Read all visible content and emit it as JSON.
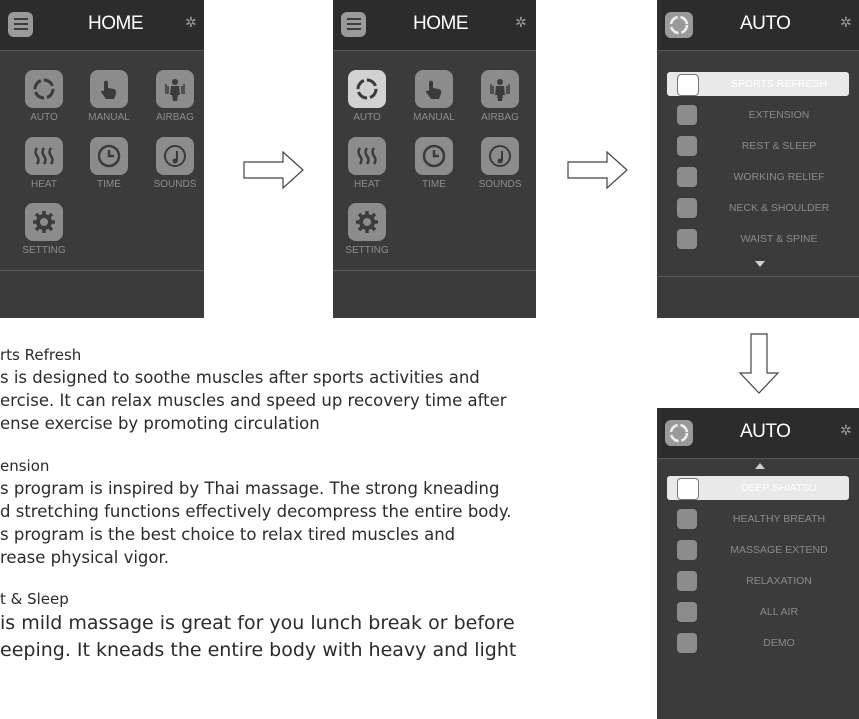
{
  "screen1": {
    "title": "HOME",
    "items": [
      {
        "label": "AUTO",
        "icon": "auto-cycle-icon"
      },
      {
        "label": "MANUAL",
        "icon": "hand-pointer-icon"
      },
      {
        "label": "AIRBAG",
        "icon": "body-airbag-icon"
      },
      {
        "label": "HEAT",
        "icon": "heat-waves-icon"
      },
      {
        "label": "TIME",
        "icon": "clock-icon"
      },
      {
        "label": "SOUNDS",
        "icon": "music-note-icon"
      },
      {
        "label": "SETTING",
        "icon": "gear-icon"
      }
    ]
  },
  "screen2": {
    "title": "HOME",
    "selected": "AUTO",
    "items": [
      {
        "label": "AUTO",
        "icon": "auto-cycle-icon"
      },
      {
        "label": "MANUAL",
        "icon": "hand-pointer-icon"
      },
      {
        "label": "AIRBAG",
        "icon": "body-airbag-icon"
      },
      {
        "label": "HEAT",
        "icon": "heat-waves-icon"
      },
      {
        "label": "TIME",
        "icon": "clock-icon"
      },
      {
        "label": "SOUNDS",
        "icon": "music-note-icon"
      },
      {
        "label": "SETTING",
        "icon": "gear-icon"
      }
    ]
  },
  "screen3": {
    "title": "AUTO",
    "programs": [
      "SPORTS REFRESH",
      "EXTENSION",
      "REST & SLEEP",
      "WORKING RELIEF",
      "NECK & SHOULDER",
      "WAIST & SPINE"
    ],
    "selected": "SPORTS REFRESH"
  },
  "screen4": {
    "title": "AUTO",
    "programs": [
      "DEEP SHIATSU",
      "HEALTHY BREATH",
      "MASSAGE EXTEND",
      "RELAXATION",
      "ALL AIR",
      "DEMO"
    ],
    "selected": "DEEP SHIATSU"
  },
  "description": {
    "sports_title": "rts Refresh",
    "sports_lines": [
      "s is designed to soothe muscles after sports activities and",
      "ercise. It can relax muscles and speed up recovery time after",
      "ense exercise by promoting circulation"
    ],
    "extension_title": "ension",
    "extension_lines": [
      "s program is inspired by Thai massage. The strong kneading",
      "d stretching functions effectively decompress the entire body.",
      "s program is the best choice to relax tired muscles and",
      "rease physical vigor."
    ],
    "rest_title": "t & Sleep",
    "rest_lines": [
      "is mild massage is great for you lunch break or before",
      "eeping. It kneads the entire body with heavy and light"
    ]
  },
  "colors": {
    "screen_bg": "#3b3b3c",
    "tile": "#8c8c8c",
    "tile_selected": "#d2d2d2",
    "text_dim": "#8d8d8d"
  }
}
